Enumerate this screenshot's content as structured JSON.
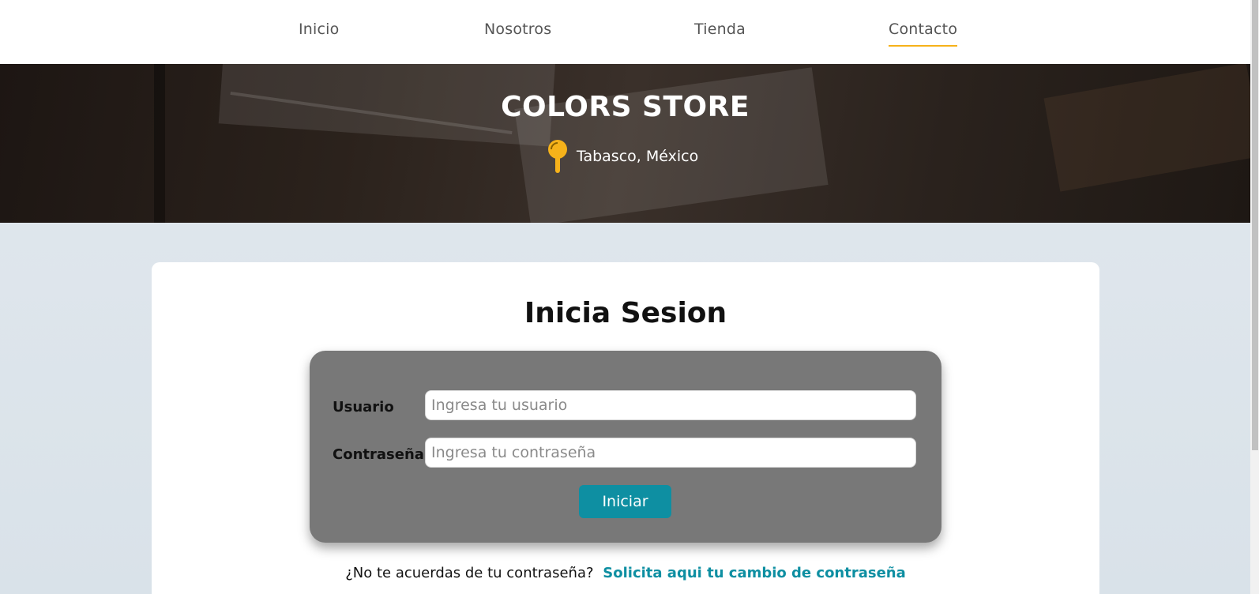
{
  "nav": {
    "items": [
      {
        "label": "Inicio",
        "active": false
      },
      {
        "label": "Nosotros",
        "active": false
      },
      {
        "label": "Tienda",
        "active": false
      },
      {
        "label": "Contacto",
        "active": true
      }
    ],
    "active_underline_color": "#f6b21a"
  },
  "hero": {
    "title": "COLORS STORE",
    "location": "Tabasco, México",
    "location_icon": "map-pin-icon"
  },
  "login": {
    "title": "Inicia Sesion",
    "username_label": "Usuario",
    "username_placeholder": "Ingresa tu usuario",
    "username_value": "",
    "password_label": "Contraseña",
    "password_placeholder": "Ingresa tu contraseña",
    "password_value": "",
    "submit_label": "Iniciar",
    "forgot_text": "¿No te acuerdas de tu contraseña?",
    "forgot_link": "Solicita aqui tu cambio de contraseña"
  },
  "colors": {
    "accent": "#f6b21a",
    "button": "#0e8fa2",
    "form_panel": "#787878"
  }
}
